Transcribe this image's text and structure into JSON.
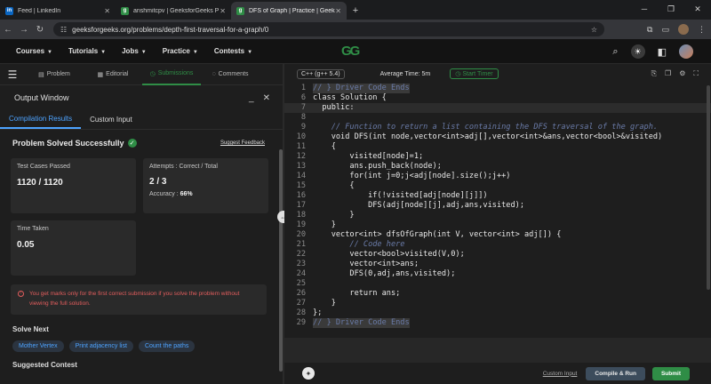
{
  "browser": {
    "tabs": [
      {
        "title": "Feed | LinkedIn",
        "favicon": "in",
        "active": false
      },
      {
        "title": "anshmitcpv | GeeksforGeeks P",
        "favicon": "g",
        "active": false
      },
      {
        "title": "DFS of Graph | Practice | Geeks",
        "favicon": "g",
        "active": true
      }
    ],
    "url": "geeksforgeeks.org/problems/depth-first-traversal-for-a-graph/0"
  },
  "site": {
    "logo": "GG",
    "nav": [
      "Courses",
      "Tutorials",
      "Jobs",
      "Practice",
      "Contests"
    ]
  },
  "left_panel": {
    "tabs": [
      "Problem",
      "Editorial",
      "Submissions",
      "Comments"
    ],
    "active_tab": "Submissions",
    "output_window_title": "Output Window",
    "subtabs": [
      "Compilation Results",
      "Custom Input"
    ],
    "status": "Problem Solved Successfully",
    "suggest_feedback": "Suggest Feedback",
    "test_cases_label": "Test Cases Passed",
    "test_cases_value": "1120 / 1120",
    "attempts_label": "Attempts : Correct / Total",
    "attempts_value": "2 / 3",
    "accuracy_label": "Accuracy :",
    "accuracy_value": "66%",
    "time_label": "Time Taken",
    "time_value": "0.05",
    "note": "You get marks only for the first correct submission if you solve the problem without viewing the full solution.",
    "solve_next_label": "Solve Next",
    "solve_next": [
      "Mother Vertex",
      "Print adjacency list",
      "Count the paths"
    ],
    "suggested_contest": "Suggested Contest"
  },
  "editor": {
    "language": "C++ (g++ 5.4)",
    "avg_time": "Average Time: 5m",
    "start_timer": "Start Timer",
    "custom_input": "Custom Input",
    "compile_run": "Compile & Run",
    "submit": "Submit",
    "lines": [
      {
        "n": "1",
        "t": "// } Driver Code Ends",
        "hl": true
      },
      {
        "n": "6",
        "t": "class Solution {"
      },
      {
        "n": "7",
        "t": "  public:",
        "cur": true
      },
      {
        "n": "8",
        "t": ""
      },
      {
        "n": "9",
        "t": "    // Function to return a list containing the DFS traversal of the graph."
      },
      {
        "n": "10",
        "t": "    void DFS(int node,vector<int>adj[],vector<int>&ans,vector<bool>&visited)"
      },
      {
        "n": "11",
        "t": "    {"
      },
      {
        "n": "12",
        "t": "        visited[node]=1;"
      },
      {
        "n": "13",
        "t": "        ans.push_back(node);"
      },
      {
        "n": "14",
        "t": "        for(int j=0;j<adj[node].size();j++)"
      },
      {
        "n": "15",
        "t": "        {"
      },
      {
        "n": "16",
        "t": "            if(!visited[adj[node][j]])"
      },
      {
        "n": "17",
        "t": "            DFS(adj[node][j],adj,ans,visited);"
      },
      {
        "n": "18",
        "t": "        }"
      },
      {
        "n": "19",
        "t": "    }"
      },
      {
        "n": "20",
        "t": "    vector<int> dfsOfGraph(int V, vector<int> adj[]) {"
      },
      {
        "n": "21",
        "t": "        // Code here"
      },
      {
        "n": "22",
        "t": "        vector<bool>visited(V,0);"
      },
      {
        "n": "23",
        "t": "        vector<int>ans;"
      },
      {
        "n": "24",
        "t": "        DFS(0,adj,ans,visited);"
      },
      {
        "n": "25",
        "t": ""
      },
      {
        "n": "26",
        "t": "        return ans;"
      },
      {
        "n": "27",
        "t": "    }"
      },
      {
        "n": "28",
        "t": "};"
      },
      {
        "n": "29",
        "t": "// } Driver Code Ends",
        "hl": true
      }
    ]
  }
}
